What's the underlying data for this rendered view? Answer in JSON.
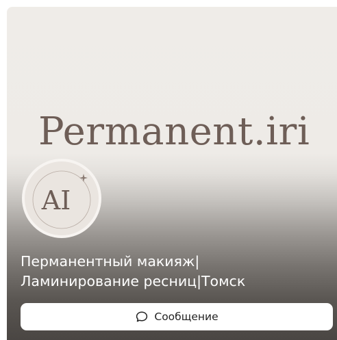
{
  "cover": {
    "brand_text": "Permanent.iri"
  },
  "avatar": {
    "monogram": "AI"
  },
  "profile": {
    "title_line1": "Перманентный макияж|",
    "title_line2": "Ламинирование ресниц|Томск"
  },
  "actions": {
    "message_label": "Сообщение",
    "message_icon": "chat-bubble-icon"
  },
  "colors": {
    "brand_text": "#6e5e57",
    "background_top": "#efece8",
    "background_bottom": "#4a4643",
    "button_bg": "#ffffff"
  }
}
